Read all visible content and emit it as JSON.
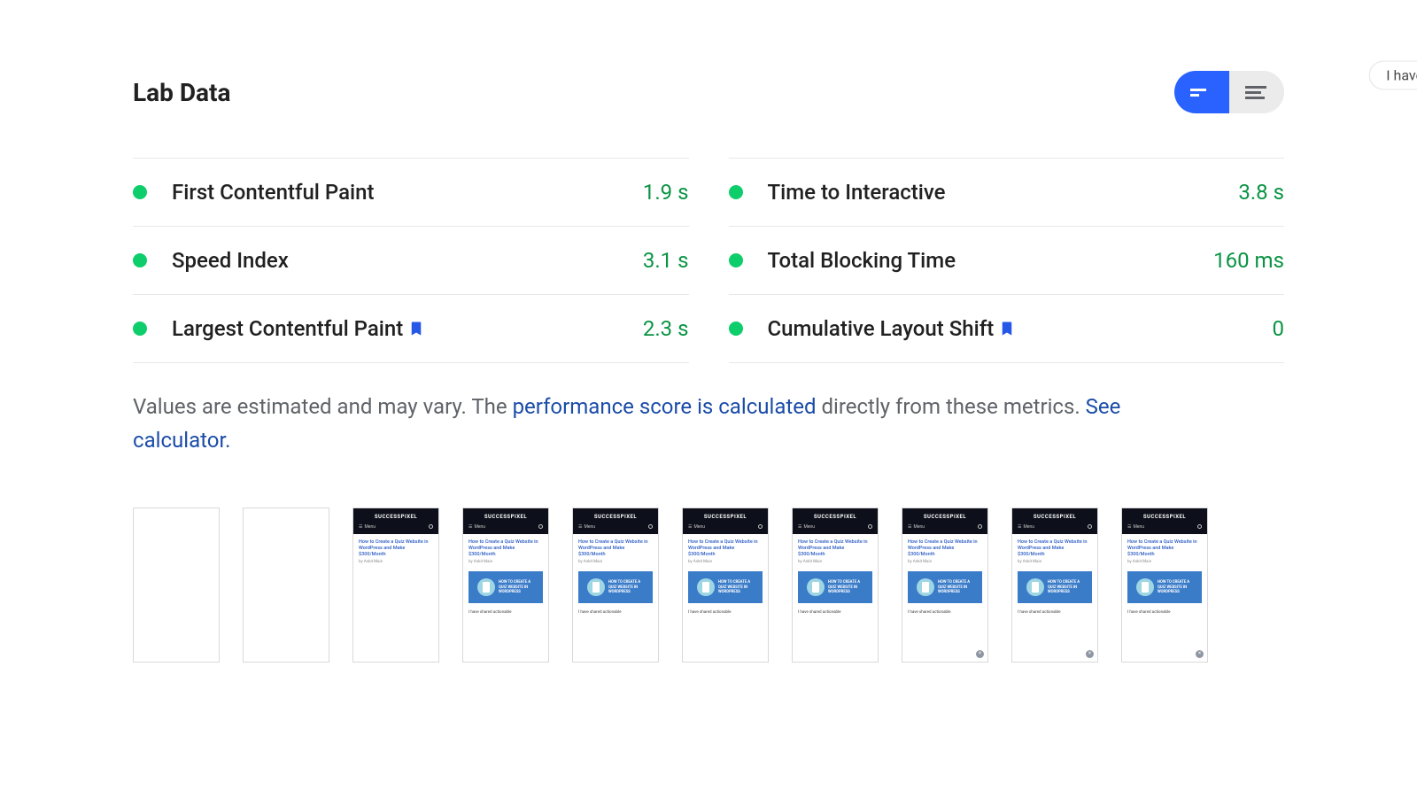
{
  "partial_button": "I have sha",
  "section_title": "Lab Data",
  "metrics_left": [
    {
      "label": "First Contentful Paint",
      "value": "1.9 s",
      "bookmark": false
    },
    {
      "label": "Speed Index",
      "value": "3.1 s",
      "bookmark": false
    },
    {
      "label": "Largest Contentful Paint",
      "value": "2.3 s",
      "bookmark": true
    }
  ],
  "metrics_right": [
    {
      "label": "Time to Interactive",
      "value": "3.8 s",
      "bookmark": false
    },
    {
      "label": "Total Blocking Time",
      "value": "160 ms",
      "bookmark": false
    },
    {
      "label": "Cumulative Layout Shift",
      "value": "0",
      "bookmark": true
    }
  ],
  "footnote": {
    "pre": "Values are estimated and may vary. The ",
    "link1": "performance score is calculated",
    "mid": " directly from these metrics. ",
    "link2": "See calculator."
  },
  "frame": {
    "brand": "SUCCESSPIXEL",
    "menu": "Menu",
    "title": "How to Create a Quiz Website in WordPress and Make $300/Month",
    "byline": "by Ankit Main",
    "hero_text": "HOW TO CREATE A QUIZ WEBSITE IN WORDPRESS",
    "caption": "I have shared actionable"
  },
  "filmstrip": [
    {
      "kind": "empty"
    },
    {
      "kind": "empty"
    },
    {
      "kind": "short"
    },
    {
      "kind": "full"
    },
    {
      "kind": "full"
    },
    {
      "kind": "full"
    },
    {
      "kind": "full"
    },
    {
      "kind": "fullclose"
    },
    {
      "kind": "fullclose"
    },
    {
      "kind": "fullclose"
    }
  ]
}
